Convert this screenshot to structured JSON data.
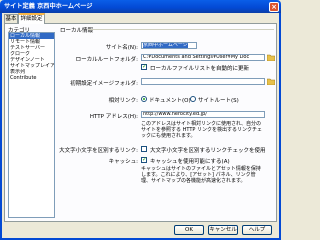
{
  "window": {
    "title": "サイト定義 京西中ホームページ",
    "close_glyph": "×"
  },
  "tabs": [
    {
      "label": "基本"
    },
    {
      "label": "詳細設定"
    }
  ],
  "category": {
    "label": "カテゴリ",
    "items": [
      "ローカル情報",
      "リモート情報",
      "テストサーバー",
      "クローク",
      "デザインノート",
      "サイトマップレイアウト",
      "表示列",
      "Contribute"
    ]
  },
  "local_info": {
    "section_title": "ローカル情報",
    "site_name_label": "サイト名(N):",
    "site_name_value": "京西中ホームページ",
    "local_root_label": "ローカルルートフォルダ:",
    "local_root_value": "C:¥Documents and Settings¥User¥My Doc",
    "auto_refresh_label": "ローカルファイルリストを自動的に更新",
    "auto_refresh_checked": true,
    "default_images_label": "初期設定イメージフォルダ:",
    "default_images_value": "",
    "links_relative_label": "相対リンク:",
    "link_option_document": "ドキュメント(O)",
    "link_option_site_root": "サイトルート(S)",
    "http_label": "HTTP アドレス(H):",
    "http_value": "http://www.nerocity.ed.jp/",
    "http_note": "このアドレスはサイト相対リンクに使用され、自分のサイトを参照する HTTP リンクを検出するリンクチェックにも使用されます。",
    "case_label": "大文字小文字を区別するリンク:",
    "case_option": "大文字小文字を区別するリンクチェックを使用",
    "cache_label": "キャッシュ:",
    "cache_option": "キャッシュを使用可能にする(A)",
    "cache_note": "キャッシュはサイトのファイルとアセット情報を保持します。これにより、[アセット] パネル、リンク管理、サイトマップの各機能が高速化されます。"
  },
  "buttons": {
    "ok": "OK",
    "cancel": "キャンセル",
    "help": "ヘルプ"
  },
  "colors": {
    "titlebar": "#0349d4",
    "selection": "#316ac5",
    "dialog_bg": "#ece9d8"
  }
}
